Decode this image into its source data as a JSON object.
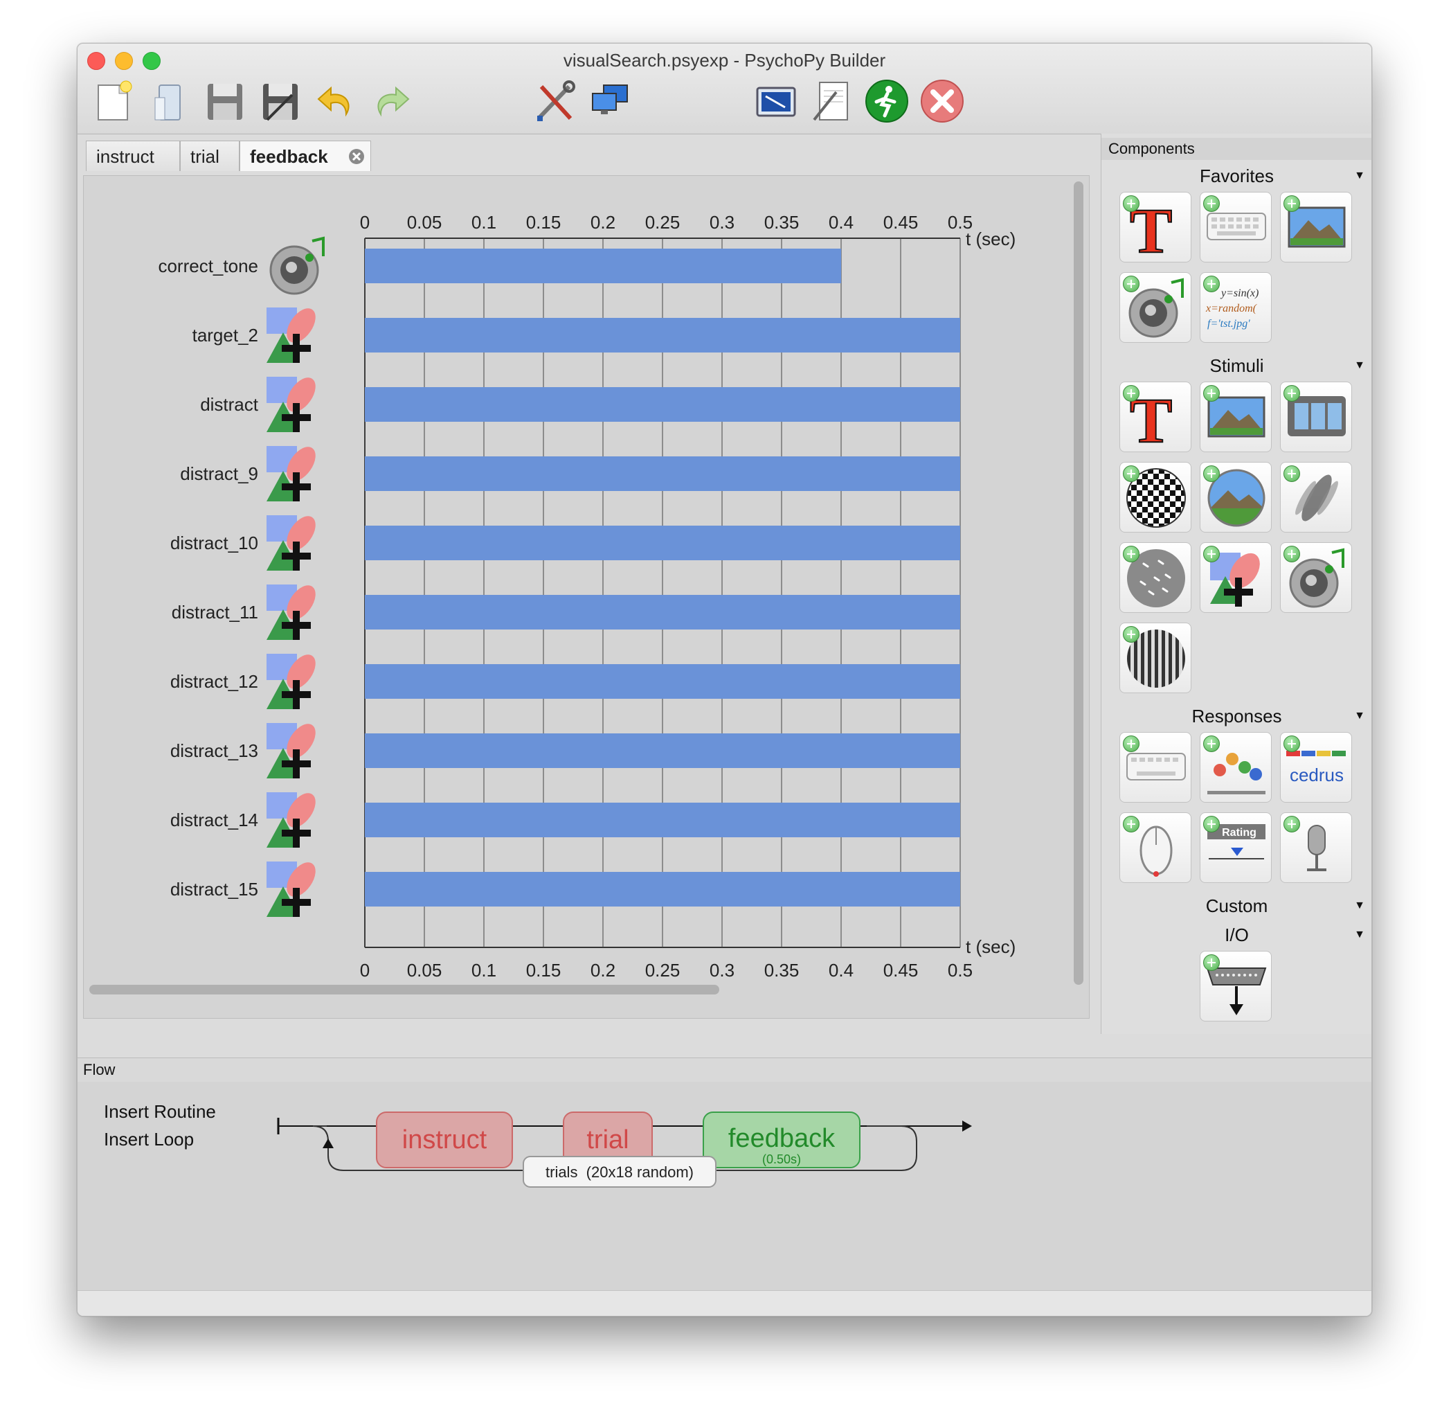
{
  "window": {
    "title": "visualSearch.psyexp - PsychoPy Builder"
  },
  "toolbar": {
    "buttons": [
      "new-file-icon",
      "open-file-icon",
      "save-icon",
      "save-as-icon",
      "undo-icon",
      "redo-icon",
      "preferences-icon",
      "monitor-center-icon",
      "experiment-settings-icon",
      "compile-script-icon",
      "run-icon",
      "stop-icon"
    ]
  },
  "routine_tabs": [
    {
      "label": "instruct"
    },
    {
      "label": "trial"
    },
    {
      "label": "feedback",
      "active": true
    }
  ],
  "timeline": {
    "axis_label": "t (sec)",
    "ticks": [
      "0",
      "0.05",
      "0.1",
      "0.15",
      "0.2",
      "0.25",
      "0.3",
      "0.35",
      "0.4",
      "0.45",
      "0.5"
    ],
    "tmax": 0.5,
    "bar_color": "#6a92d8",
    "components": [
      {
        "name": "correct_tone",
        "icon": "sound-icon",
        "start": 0,
        "stop": 0.4
      },
      {
        "name": "target_2",
        "icon": "polygon-icon",
        "start": 0,
        "stop": 0.5
      },
      {
        "name": "distract",
        "icon": "polygon-icon",
        "start": 0,
        "stop": 0.5
      },
      {
        "name": "distract_9",
        "icon": "polygon-icon",
        "start": 0,
        "stop": 0.5
      },
      {
        "name": "distract_10",
        "icon": "polygon-icon",
        "start": 0,
        "stop": 0.5
      },
      {
        "name": "distract_11",
        "icon": "polygon-icon",
        "start": 0,
        "stop": 0.5
      },
      {
        "name": "distract_12",
        "icon": "polygon-icon",
        "start": 0,
        "stop": 0.5
      },
      {
        "name": "distract_13",
        "icon": "polygon-icon",
        "start": 0,
        "stop": 0.5
      },
      {
        "name": "distract_14",
        "icon": "polygon-icon",
        "start": 0,
        "stop": 0.5
      },
      {
        "name": "distract_15",
        "icon": "polygon-icon",
        "start": 0,
        "stop": 0.5
      }
    ]
  },
  "components_panel": {
    "title": "Components",
    "categories": [
      {
        "label": "Favorites",
        "items": [
          "text-icon",
          "keyboard-icon",
          "image-icon",
          "sound-icon",
          "code-icon"
        ]
      },
      {
        "label": "Stimuli",
        "items": [
          "text-icon",
          "image-icon",
          "movie-icon",
          "noise-icon",
          "aperture-icon",
          "grating-icon",
          "dots-icon",
          "polygon-icon",
          "sound-icon",
          "envelope-grating-icon"
        ]
      },
      {
        "label": "Responses",
        "items": [
          "keyboard-icon",
          "joystick-icon",
          "cedrus-icon",
          "mouse-icon",
          "rating-icon",
          "microphone-icon"
        ]
      },
      {
        "label": "Custom",
        "items": []
      },
      {
        "label": "I/O",
        "items": [
          "parallel-out-icon"
        ]
      }
    ],
    "code_lines": [
      "y=sin(x)",
      "x=random(",
      "f='tst.jpg'"
    ],
    "cedrus_label": "cedrus",
    "rating_label": "Rating"
  },
  "flow": {
    "title": "Flow",
    "insert_routine": "Insert Routine",
    "insert_loop": "Insert Loop",
    "routines": [
      {
        "label": "instruct",
        "color": "#d9a3a3",
        "text_color": "#cc4444"
      },
      {
        "label": "trial",
        "color": "#d9a3a3",
        "text_color": "#cc4444"
      },
      {
        "label": "feedback",
        "sub": "(0.50s)",
        "color": "#a8d6a8",
        "text_color": "#2a8a2a"
      }
    ],
    "loop": {
      "label": "trials  (20x18 random)"
    }
  }
}
